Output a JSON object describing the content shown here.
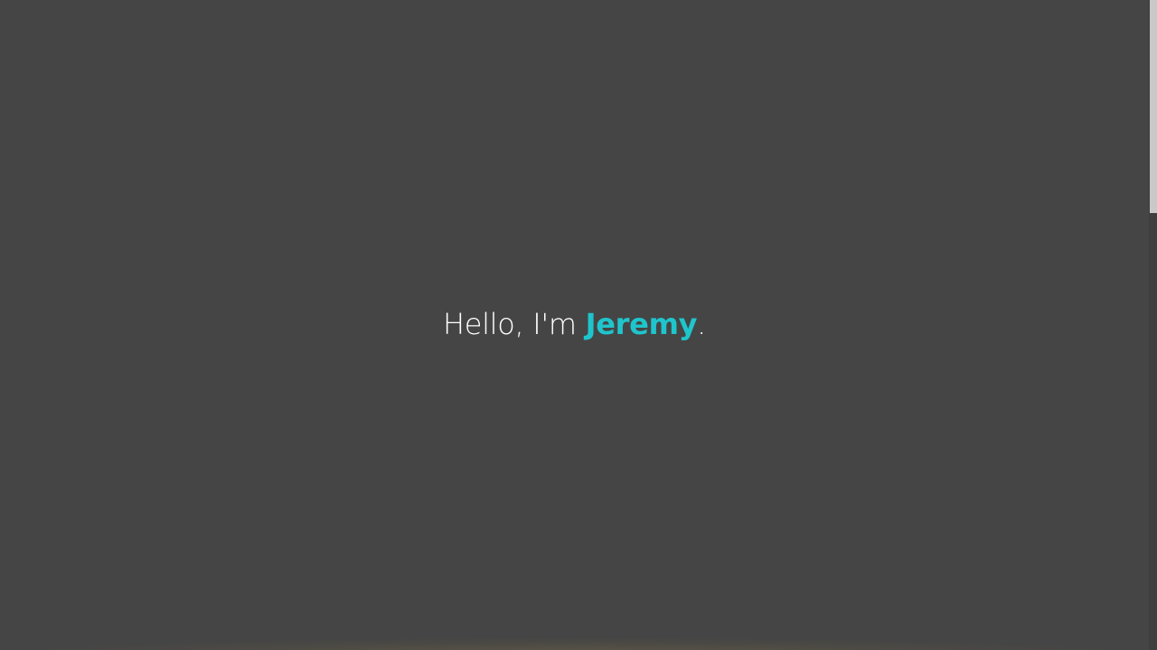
{
  "hero": {
    "greeting_prefix": "Hello, I'm ",
    "name": "Jeremy",
    "greeting_suffix": "."
  },
  "colors": {
    "background": "#454545",
    "accent": "#1fc5cc",
    "text": "#ffffff"
  }
}
